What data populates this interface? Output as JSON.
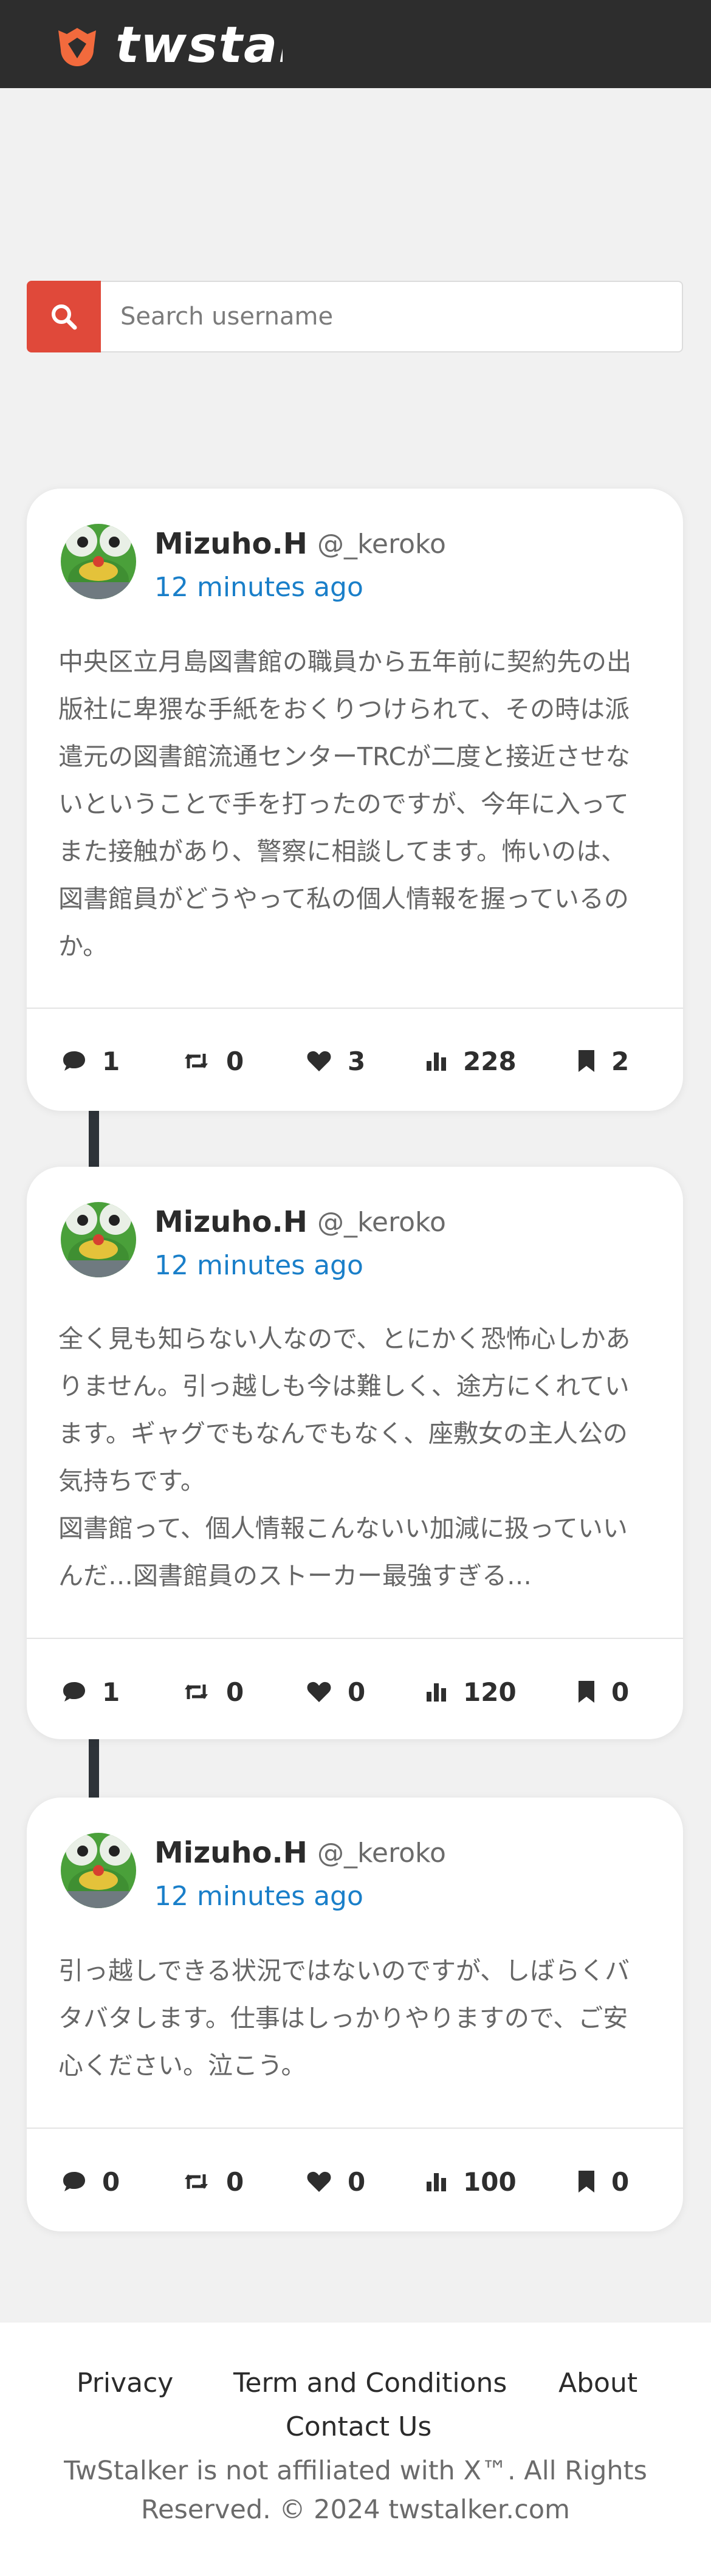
{
  "header": {
    "brand": "twstalker",
    "logo_icon": "twstalker-logo-icon"
  },
  "search": {
    "placeholder": "Search username",
    "icon": "search-icon"
  },
  "accent_colors": {
    "header_bg": "#2d2d2d",
    "search_button": "#e0493a",
    "time_link": "#1a7fc9",
    "connector": "#2e3339"
  },
  "tweets": [
    {
      "name": "Mizuho.H",
      "handle": "@_keroko",
      "time": "12 minutes ago",
      "text": "中央区立月島図書館の職員から五年前に契約先の出\n版社に卑猥な手紙をおくりつけられて、その時は派\n遣元の図書館流通センターTRCが二度と接近させな\nいということで手を打ったのですが、今年に入って\nまた接触があり、警察に相談してます。怖いのは、\n図書館員がどうやって私の個人情報を握っているの\nか。",
      "stats": {
        "replies": "1",
        "retweets": "0",
        "likes": "3",
        "views": "228",
        "bookmarks": "2"
      }
    },
    {
      "name": "Mizuho.H",
      "handle": "@_keroko",
      "time": "12 minutes ago",
      "text": "全く見も知らない人なので、とにかく恐怖心しかあ\nりません。引っ越しも今は難しく、途方にくれてい\nます。ギャグでもなんでもなく、座敷女の主人公の\n気持ちです。\n図書館って、個人情報こんないい加減に扱っていい\nんだ…図書館員のストーカー最強すぎる…",
      "stats": {
        "replies": "1",
        "retweets": "0",
        "likes": "0",
        "views": "120",
        "bookmarks": "0"
      }
    },
    {
      "name": "Mizuho.H",
      "handle": "@_keroko",
      "time": "12 minutes ago",
      "text": "引っ越しできる状況ではないのですが、しばらくバ\nタバタします。仕事はしっかりやりますので、ご安\n心ください。泣こう。",
      "stats": {
        "replies": "0",
        "retweets": "0",
        "likes": "0",
        "views": "100",
        "bookmarks": "0"
      }
    }
  ],
  "footer": {
    "privacy": "Privacy",
    "terms": "Term and Conditions",
    "about": "About",
    "contact": "Contact Us",
    "note_line1": "TwStalker is not affiliated with X™. All Rights",
    "note_line2": "Reserved. © 2024 twstalker.com"
  }
}
